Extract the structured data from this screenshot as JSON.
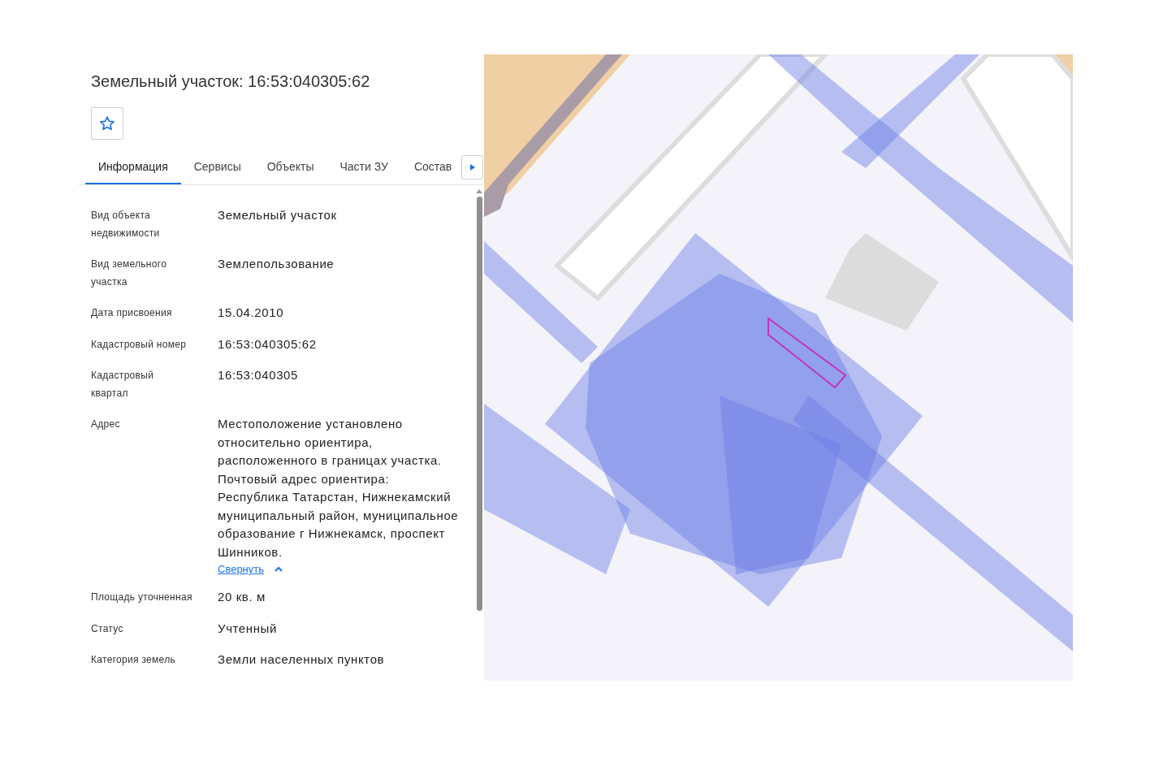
{
  "title": "Земельный участок: 16:53:040305:62",
  "favorite": {
    "selected": false
  },
  "tabs": [
    {
      "label": "Информация",
      "selected": true
    },
    {
      "label": "Сервисы",
      "selected": false
    },
    {
      "label": "Объекты",
      "selected": false
    },
    {
      "label": "Части ЗУ",
      "selected": false
    },
    {
      "label": "Состав",
      "selected": false
    }
  ],
  "fields": [
    {
      "label": "Вид объекта недвижимости",
      "value": "Земельный участок"
    },
    {
      "label": "Вид земельного участка",
      "value": "Землепользование"
    },
    {
      "label": "Дата присвоения",
      "value": "15.04.2010"
    },
    {
      "label": "Кадастровый номер",
      "value": "16:53:040305:62"
    },
    {
      "label": "Кадастровый квартал",
      "value": "16:53:040305"
    },
    {
      "label": "Адрес",
      "value": "Местоположение установлено относительно ориентира, расположенного в границах участка. Почтовый адрес ориентира: Республика Татарстан, Нижнекамский муниципальный район, муниципальное образование г Нижнекамск, проспект Шинников.",
      "toggle": {
        "label": "Свернуть",
        "expanded": true
      }
    },
    {
      "label": "Площадь уточненная",
      "value": "20 кв. м"
    },
    {
      "label": "Статус",
      "value": "Учтенный"
    },
    {
      "label": "Категория земель",
      "value": "Земли населенных пунктов"
    }
  ]
}
